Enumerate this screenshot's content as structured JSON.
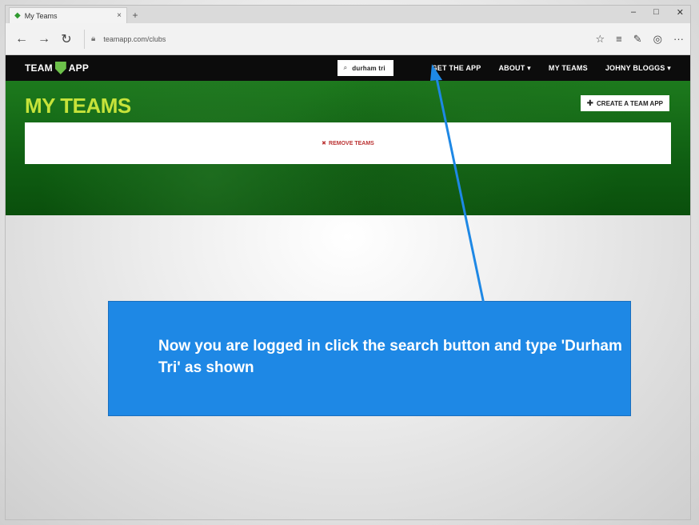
{
  "browser": {
    "tab_title": "My Teams",
    "tab_close": "×",
    "new_tab": "+",
    "window_controls": [
      "–",
      "□",
      "✕"
    ],
    "url": "teamapp.com/clubs",
    "nav": {
      "back": "←",
      "forward": "→",
      "refresh": "↻"
    },
    "tools": [
      "☆",
      "≡",
      "✎",
      "◎",
      "···"
    ]
  },
  "site": {
    "logo_left": "TEAM",
    "logo_right": "APP",
    "search_value": "durham tri",
    "nav_items": [
      "GET THE APP",
      "ABOUT ▾",
      "MY TEAMS",
      "JOHNY BLOGGS ▾"
    ],
    "page_title": "MY TEAMS",
    "create_button": "CREATE A TEAM APP",
    "remove_teams": "REMOVE TEAMS"
  },
  "callout": {
    "text": "Now you are logged in click the search button and type 'Durham Tri' as shown"
  },
  "colors": {
    "callout": "#1e88e5",
    "title_green": "#c6e33a",
    "hero_green": "#1d7a1d"
  }
}
